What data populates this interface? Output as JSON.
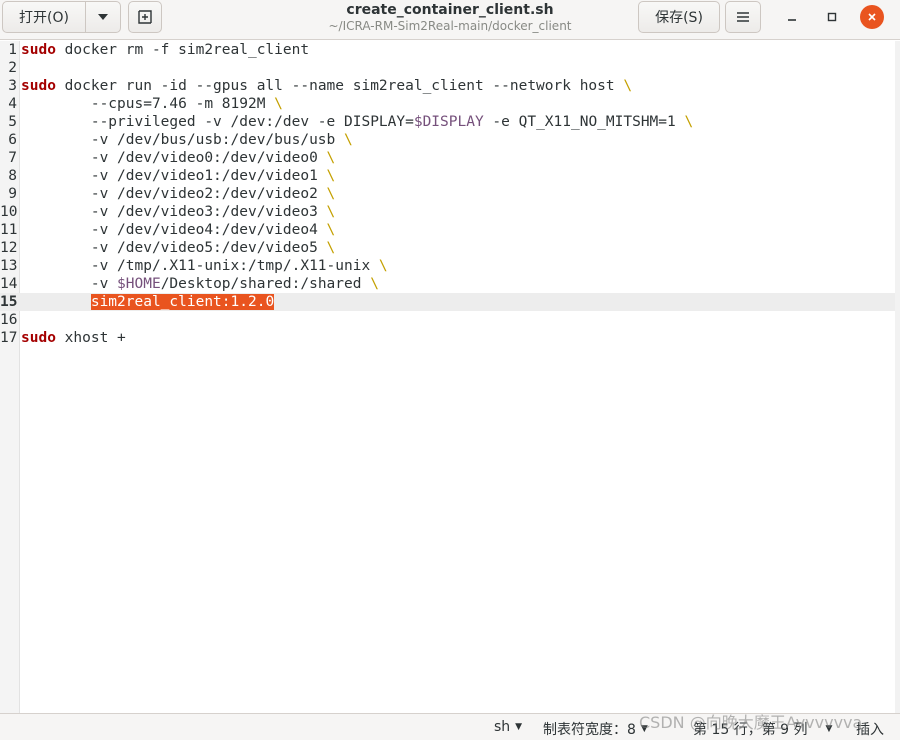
{
  "header": {
    "open_label": "打开(O)",
    "save_label": "保存(S)",
    "title": "create_container_client.sh",
    "path": "~/ICRA-RM-Sim2Real-main/docker_client",
    "close_color": "#e9541f"
  },
  "editor": {
    "current_line": 15,
    "lines": [
      {
        "n": "1",
        "s": [
          {
            "t": "sudo",
            "c": "kw"
          },
          {
            "t": " docker rm -f sim2real_client"
          }
        ]
      },
      {
        "n": "2",
        "s": []
      },
      {
        "n": "3",
        "s": [
          {
            "t": "sudo",
            "c": "kw"
          },
          {
            "t": " docker run -id --gpus all --name sim2real_client --network host "
          },
          {
            "t": "\\",
            "c": "bs"
          }
        ]
      },
      {
        "n": "4",
        "s": [
          {
            "t": "        --cpus=7.46 -m 8192M "
          },
          {
            "t": "\\",
            "c": "bs"
          }
        ]
      },
      {
        "n": "5",
        "s": [
          {
            "t": "        --privileged -v /dev:/dev -e DISPLAY="
          },
          {
            "t": "$DISPLAY",
            "c": "var"
          },
          {
            "t": " -e QT_X11_NO_MITSHM=1 "
          },
          {
            "t": "\\",
            "c": "bs"
          }
        ]
      },
      {
        "n": "6",
        "s": [
          {
            "t": "        -v /dev/bus/usb:/dev/bus/usb "
          },
          {
            "t": "\\",
            "c": "bs"
          }
        ]
      },
      {
        "n": "7",
        "s": [
          {
            "t": "        -v /dev/video0:/dev/video0 "
          },
          {
            "t": "\\",
            "c": "bs"
          }
        ]
      },
      {
        "n": "8",
        "s": [
          {
            "t": "        -v /dev/video1:/dev/video1 "
          },
          {
            "t": "\\",
            "c": "bs"
          }
        ]
      },
      {
        "n": "9",
        "s": [
          {
            "t": "        -v /dev/video2:/dev/video2 "
          },
          {
            "t": "\\",
            "c": "bs"
          }
        ]
      },
      {
        "n": "10",
        "s": [
          {
            "t": "        -v /dev/video3:/dev/video3 "
          },
          {
            "t": "\\",
            "c": "bs"
          }
        ]
      },
      {
        "n": "11",
        "s": [
          {
            "t": "        -v /dev/video4:/dev/video4 "
          },
          {
            "t": "\\",
            "c": "bs"
          }
        ]
      },
      {
        "n": "12",
        "s": [
          {
            "t": "        -v /dev/video5:/dev/video5 "
          },
          {
            "t": "\\",
            "c": "bs"
          }
        ]
      },
      {
        "n": "13",
        "s": [
          {
            "t": "        -v /tmp/.X11-unix:/tmp/.X11-unix "
          },
          {
            "t": "\\",
            "c": "bs"
          }
        ]
      },
      {
        "n": "14",
        "s": [
          {
            "t": "        -v "
          },
          {
            "t": "$HOME",
            "c": "var"
          },
          {
            "t": "/Desktop/shared:/shared "
          },
          {
            "t": "\\",
            "c": "bs"
          }
        ]
      },
      {
        "n": "15",
        "s": [
          {
            "t": "        "
          },
          {
            "t": "sim2real_client:1.2.0",
            "c": "sel"
          }
        ]
      },
      {
        "n": "16",
        "s": []
      },
      {
        "n": "17",
        "s": [
          {
            "t": "sudo",
            "c": "kw"
          },
          {
            "t": " xhost +"
          }
        ]
      }
    ]
  },
  "status": {
    "language": "sh",
    "tab_width": "制表符宽度：8",
    "position": "第 15 行，第 9 列",
    "mode": "插入"
  },
  "watermark": "CSDN @向晚大魔王Avvvvvva"
}
